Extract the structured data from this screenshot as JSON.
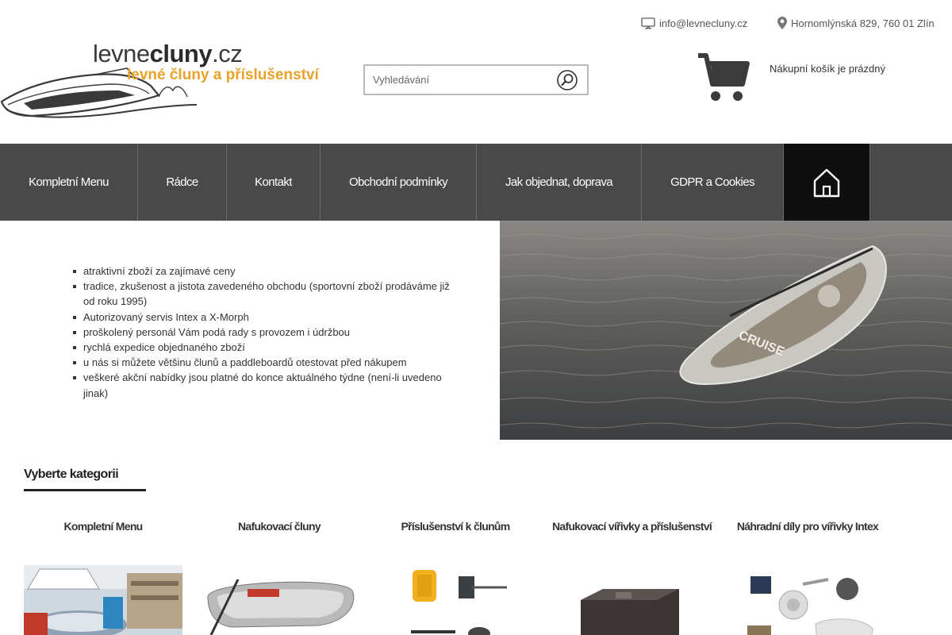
{
  "header": {
    "email": "info@levnecluny.cz",
    "address": "Hornomlýnská 829, 760 01 Zlín",
    "logo_main": "levne",
    "logo_bold": "cluny",
    "logo_suffix": ".cz",
    "logo_tagline": "levné čluny a příslušenství",
    "search_placeholder": "Vyhledávání",
    "cart_status": "Nákupní košík je prázdný"
  },
  "nav": {
    "items": [
      {
        "label": "Kompletní Menu"
      },
      {
        "label": "Rádce"
      },
      {
        "label": "Kontakt"
      },
      {
        "label": "Obchodní podmínky"
      },
      {
        "label": "Jak objednat, doprava"
      },
      {
        "label": "GDPR a Cookies"
      }
    ],
    "home_icon": "home-icon"
  },
  "hero": {
    "bullets": [
      "atraktivní zboží za zajímavé ceny",
      "tradice, zkušenost a jistota zavedeného obchodu (sportovní zboží prodáváme již od roku 1995)",
      "Autorizovaný servis Intex a X-Morph",
      "proškolený personál Vám podá rady s provozem i údržbou",
      "rychlá expedice objednaného zboží",
      "u nás si můžete většinu člunů a paddleboardů otestovat před nákupem",
      "veškeré akční nabídky jsou platné do konce aktuálného týdne (není-li uvedeno jinak)"
    ],
    "image_board_text": "CRUISE"
  },
  "categories": {
    "heading": "Vyberte kategorii",
    "items": [
      {
        "label": "Kompletní Menu"
      },
      {
        "label": "Nafukovací čluny"
      },
      {
        "label": "Příslušenství k člunům"
      },
      {
        "label": "Nafukovací vířivky a příslušenství"
      },
      {
        "label": "Náhradní díly pro vířivky Intex"
      }
    ]
  },
  "colors": {
    "nav_bg": "#494949",
    "nav_home_bg": "#0f0f0f",
    "logo_accent": "#e8a22a"
  }
}
